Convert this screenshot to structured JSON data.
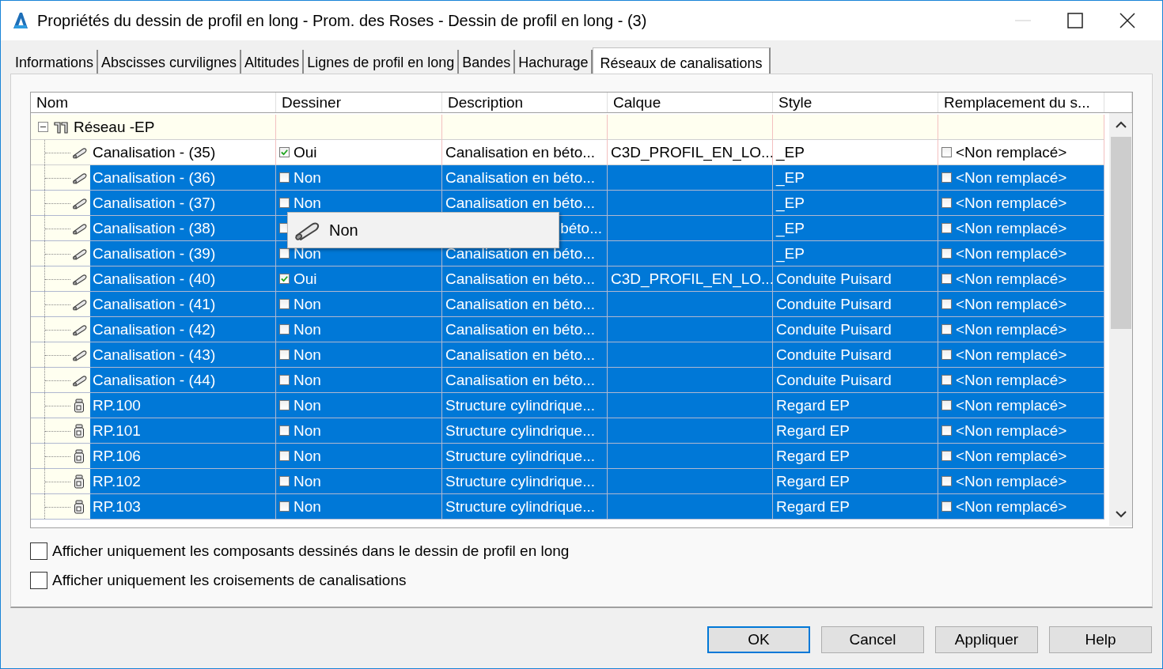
{
  "window": {
    "title": "Propriétés du dessin de profil en long - Prom. des Roses - Dessin de profil en long - (3)"
  },
  "tabs": [
    {
      "label": "Informations",
      "selected": false
    },
    {
      "label": "Abscisses curvilignes",
      "selected": false
    },
    {
      "label": "Altitudes",
      "selected": false
    },
    {
      "label": "Lignes de profil en long",
      "selected": false
    },
    {
      "label": "Bandes",
      "selected": false
    },
    {
      "label": "Hachurage",
      "selected": false
    },
    {
      "label": "Réseaux de canalisations",
      "selected": true
    }
  ],
  "table": {
    "columns": [
      "Nom",
      "Dessiner",
      "Description",
      "Calque",
      "Style",
      "Remplacement du s..."
    ],
    "network": {
      "name": "Réseau -EP",
      "expanded": true,
      "children": [
        {
          "kind": "pipe",
          "name": "Canalisation - (35)",
          "selected": false,
          "draw": {
            "checked": true,
            "label": "Oui"
          },
          "description": "Canalisation en béto...",
          "layer": "C3D_PROFIL_EN_LO...",
          "style": "_EP",
          "override": {
            "checked": false,
            "label": "<Non remplacé>"
          }
        },
        {
          "kind": "pipe",
          "name": "Canalisation - (36)",
          "selected": true,
          "draw": {
            "checked": false,
            "label": "Non"
          },
          "description": "Canalisation en béto...",
          "style": "_EP",
          "override": {
            "checked": false,
            "label": "<Non remplacé>"
          }
        },
        {
          "kind": "pipe",
          "name": "Canalisation - (37)",
          "selected": true,
          "draw": {
            "checked": false,
            "label": "Non"
          },
          "description": "Canalisation en béto...",
          "style": "_EP",
          "override": {
            "checked": false,
            "label": "<Non remplacé>"
          }
        },
        {
          "kind": "pipe",
          "name": "Canalisation - (38)",
          "selected": true,
          "draw": {
            "checked": false
          },
          "description": "béto...",
          "description_partial": true,
          "style": "_EP",
          "override": {
            "checked": false,
            "label": "<Non remplacé>"
          }
        },
        {
          "kind": "pipe",
          "name": "Canalisation - (39)",
          "selected": true,
          "draw": {
            "checked": false,
            "label": "Non"
          },
          "description": "Canalisation en béto...",
          "style": "_EP",
          "override": {
            "checked": false,
            "label": "<Non remplacé>"
          }
        },
        {
          "kind": "pipe",
          "name": "Canalisation - (40)",
          "selected": true,
          "draw": {
            "checked": true,
            "label": "Oui"
          },
          "description": "Canalisation en béto...",
          "layer": "C3D_PROFIL_EN_LO...",
          "style": "Conduite Puisard",
          "override": {
            "checked": false,
            "label": "<Non remplacé>"
          }
        },
        {
          "kind": "pipe",
          "name": "Canalisation - (41)",
          "selected": true,
          "draw": {
            "checked": false,
            "label": "Non"
          },
          "description": "Canalisation en béto...",
          "style": "Conduite Puisard",
          "override": {
            "checked": false,
            "label": "<Non remplacé>"
          }
        },
        {
          "kind": "pipe",
          "name": "Canalisation - (42)",
          "selected": true,
          "draw": {
            "checked": false,
            "label": "Non"
          },
          "description": "Canalisation en béto...",
          "style": "Conduite Puisard",
          "override": {
            "checked": false,
            "label": "<Non remplacé>"
          }
        },
        {
          "kind": "pipe",
          "name": "Canalisation - (43)",
          "selected": true,
          "draw": {
            "checked": false,
            "label": "Non"
          },
          "description": "Canalisation en béto...",
          "style": "Conduite Puisard",
          "override": {
            "checked": false,
            "label": "<Non remplacé>"
          }
        },
        {
          "kind": "pipe",
          "name": "Canalisation - (44)",
          "selected": true,
          "draw": {
            "checked": false,
            "label": "Non"
          },
          "description": "Canalisation en béto...",
          "style": "Conduite Puisard",
          "override": {
            "checked": false,
            "label": "<Non remplacé>"
          }
        },
        {
          "kind": "structure",
          "name": "RP.100",
          "selected": true,
          "draw": {
            "checked": false,
            "label": "Non"
          },
          "description": "Structure cylindrique...",
          "style": "Regard EP",
          "override": {
            "checked": false,
            "label": "<Non remplacé>"
          }
        },
        {
          "kind": "structure",
          "name": "RP.101",
          "selected": true,
          "draw": {
            "checked": false,
            "label": "Non"
          },
          "description": "Structure cylindrique...",
          "style": "Regard EP",
          "override": {
            "checked": false,
            "label": "<Non remplacé>"
          }
        },
        {
          "kind": "structure",
          "name": "RP.106",
          "selected": true,
          "draw": {
            "checked": false,
            "label": "Non"
          },
          "description": "Structure cylindrique...",
          "style": "Regard EP",
          "override": {
            "checked": false,
            "label": "<Non remplacé>"
          }
        },
        {
          "kind": "structure",
          "name": "RP.102",
          "selected": true,
          "draw": {
            "checked": false,
            "label": "Non"
          },
          "description": "Structure cylindrique...",
          "style": "Regard EP",
          "override": {
            "checked": false,
            "label": "<Non remplacé>"
          }
        },
        {
          "kind": "structure",
          "name": "RP.103",
          "selected": true,
          "draw": {
            "checked": false,
            "label": "Non"
          },
          "description": "Structure cylindrique...",
          "style": "Regard EP",
          "override": {
            "checked": false,
            "label": "<Non remplacé>"
          }
        }
      ]
    }
  },
  "dropdown_popup": {
    "label": "Non"
  },
  "options": [
    {
      "label": "Afficher uniquement les composants dessinés dans le dessin de profil en long",
      "checked": false
    },
    {
      "label": "Afficher uniquement les croisements de canalisations",
      "checked": false
    }
  ],
  "buttons": [
    {
      "label": "OK",
      "default": true
    },
    {
      "label": "Cancel",
      "default": false
    },
    {
      "label": "Appliquer",
      "default": false
    },
    {
      "label": "Help",
      "default": false
    }
  ]
}
